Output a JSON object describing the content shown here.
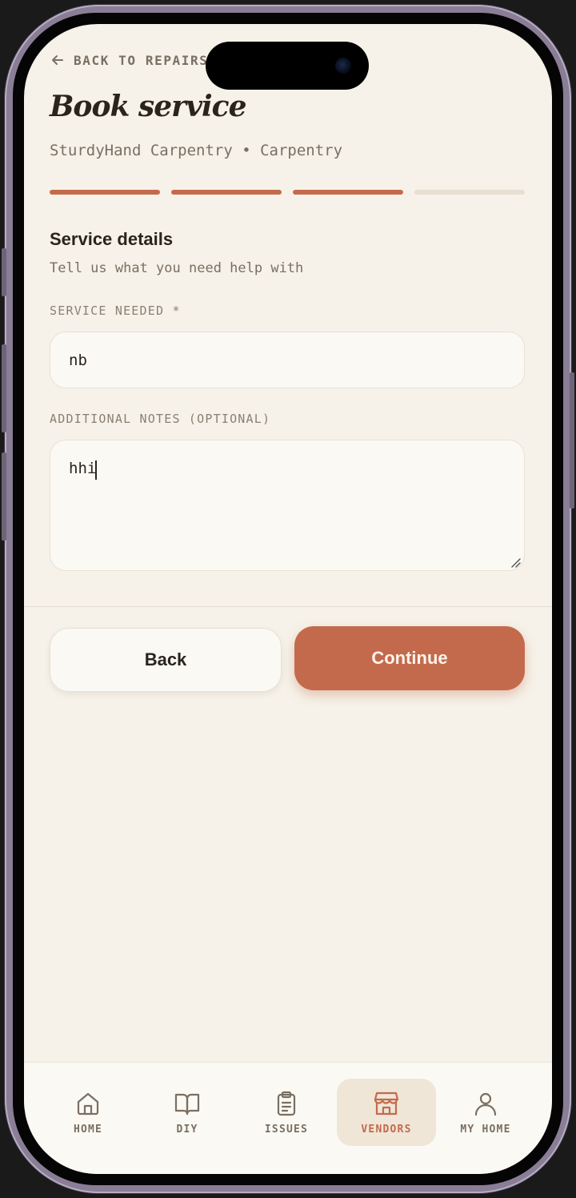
{
  "header": {
    "back_link": "BACK TO REPAIRS",
    "title": "Book service",
    "subtitle": "SturdyHand Carpentry • Carpentry"
  },
  "progress": {
    "total_steps": 4,
    "completed_steps": 3
  },
  "section": {
    "title": "Service details",
    "description": "Tell us what you need help with"
  },
  "form": {
    "service_label": "SERVICE NEEDED *",
    "service_value": "nb",
    "notes_label": "ADDITIONAL NOTES (OPTIONAL)",
    "notes_value": "hhi"
  },
  "actions": {
    "back_label": "Back",
    "continue_label": "Continue"
  },
  "tabbar": {
    "items": [
      {
        "label": "HOME",
        "icon": "home-icon"
      },
      {
        "label": "DIY",
        "icon": "book-icon"
      },
      {
        "label": "ISSUES",
        "icon": "clipboard-icon"
      },
      {
        "label": "VENDORS",
        "icon": "storefront-icon",
        "active": true
      },
      {
        "label": "MY HOME",
        "icon": "user-icon"
      }
    ]
  },
  "colors": {
    "accent": "#c46a4c",
    "background": "#f6f2e9",
    "text": "#2a241d",
    "muted": "#7a6f62"
  }
}
